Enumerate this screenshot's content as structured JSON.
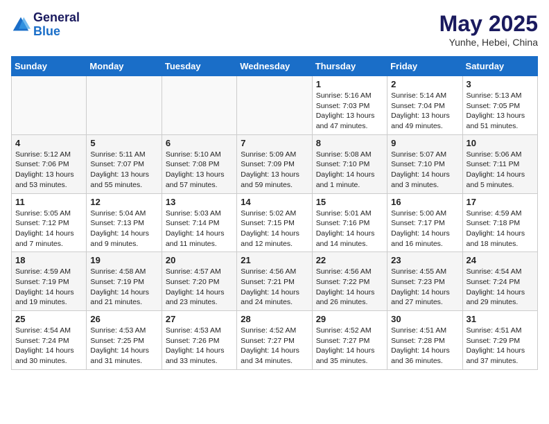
{
  "header": {
    "logo_line1": "General",
    "logo_line2": "Blue",
    "month_year": "May 2025",
    "location": "Yunhe, Hebei, China"
  },
  "weekdays": [
    "Sunday",
    "Monday",
    "Tuesday",
    "Wednesday",
    "Thursday",
    "Friday",
    "Saturday"
  ],
  "weeks": [
    [
      {
        "day": "",
        "info": ""
      },
      {
        "day": "",
        "info": ""
      },
      {
        "day": "",
        "info": ""
      },
      {
        "day": "",
        "info": ""
      },
      {
        "day": "1",
        "info": "Sunrise: 5:16 AM\nSunset: 7:03 PM\nDaylight: 13 hours\nand 47 minutes."
      },
      {
        "day": "2",
        "info": "Sunrise: 5:14 AM\nSunset: 7:04 PM\nDaylight: 13 hours\nand 49 minutes."
      },
      {
        "day": "3",
        "info": "Sunrise: 5:13 AM\nSunset: 7:05 PM\nDaylight: 13 hours\nand 51 minutes."
      }
    ],
    [
      {
        "day": "4",
        "info": "Sunrise: 5:12 AM\nSunset: 7:06 PM\nDaylight: 13 hours\nand 53 minutes."
      },
      {
        "day": "5",
        "info": "Sunrise: 5:11 AM\nSunset: 7:07 PM\nDaylight: 13 hours\nand 55 minutes."
      },
      {
        "day": "6",
        "info": "Sunrise: 5:10 AM\nSunset: 7:08 PM\nDaylight: 13 hours\nand 57 minutes."
      },
      {
        "day": "7",
        "info": "Sunrise: 5:09 AM\nSunset: 7:09 PM\nDaylight: 13 hours\nand 59 minutes."
      },
      {
        "day": "8",
        "info": "Sunrise: 5:08 AM\nSunset: 7:10 PM\nDaylight: 14 hours\nand 1 minute."
      },
      {
        "day": "9",
        "info": "Sunrise: 5:07 AM\nSunset: 7:10 PM\nDaylight: 14 hours\nand 3 minutes."
      },
      {
        "day": "10",
        "info": "Sunrise: 5:06 AM\nSunset: 7:11 PM\nDaylight: 14 hours\nand 5 minutes."
      }
    ],
    [
      {
        "day": "11",
        "info": "Sunrise: 5:05 AM\nSunset: 7:12 PM\nDaylight: 14 hours\nand 7 minutes."
      },
      {
        "day": "12",
        "info": "Sunrise: 5:04 AM\nSunset: 7:13 PM\nDaylight: 14 hours\nand 9 minutes."
      },
      {
        "day": "13",
        "info": "Sunrise: 5:03 AM\nSunset: 7:14 PM\nDaylight: 14 hours\nand 11 minutes."
      },
      {
        "day": "14",
        "info": "Sunrise: 5:02 AM\nSunset: 7:15 PM\nDaylight: 14 hours\nand 12 minutes."
      },
      {
        "day": "15",
        "info": "Sunrise: 5:01 AM\nSunset: 7:16 PM\nDaylight: 14 hours\nand 14 minutes."
      },
      {
        "day": "16",
        "info": "Sunrise: 5:00 AM\nSunset: 7:17 PM\nDaylight: 14 hours\nand 16 minutes."
      },
      {
        "day": "17",
        "info": "Sunrise: 4:59 AM\nSunset: 7:18 PM\nDaylight: 14 hours\nand 18 minutes."
      }
    ],
    [
      {
        "day": "18",
        "info": "Sunrise: 4:59 AM\nSunset: 7:19 PM\nDaylight: 14 hours\nand 19 minutes."
      },
      {
        "day": "19",
        "info": "Sunrise: 4:58 AM\nSunset: 7:19 PM\nDaylight: 14 hours\nand 21 minutes."
      },
      {
        "day": "20",
        "info": "Sunrise: 4:57 AM\nSunset: 7:20 PM\nDaylight: 14 hours\nand 23 minutes."
      },
      {
        "day": "21",
        "info": "Sunrise: 4:56 AM\nSunset: 7:21 PM\nDaylight: 14 hours\nand 24 minutes."
      },
      {
        "day": "22",
        "info": "Sunrise: 4:56 AM\nSunset: 7:22 PM\nDaylight: 14 hours\nand 26 minutes."
      },
      {
        "day": "23",
        "info": "Sunrise: 4:55 AM\nSunset: 7:23 PM\nDaylight: 14 hours\nand 27 minutes."
      },
      {
        "day": "24",
        "info": "Sunrise: 4:54 AM\nSunset: 7:24 PM\nDaylight: 14 hours\nand 29 minutes."
      }
    ],
    [
      {
        "day": "25",
        "info": "Sunrise: 4:54 AM\nSunset: 7:24 PM\nDaylight: 14 hours\nand 30 minutes."
      },
      {
        "day": "26",
        "info": "Sunrise: 4:53 AM\nSunset: 7:25 PM\nDaylight: 14 hours\nand 31 minutes."
      },
      {
        "day": "27",
        "info": "Sunrise: 4:53 AM\nSunset: 7:26 PM\nDaylight: 14 hours\nand 33 minutes."
      },
      {
        "day": "28",
        "info": "Sunrise: 4:52 AM\nSunset: 7:27 PM\nDaylight: 14 hours\nand 34 minutes."
      },
      {
        "day": "29",
        "info": "Sunrise: 4:52 AM\nSunset: 7:27 PM\nDaylight: 14 hours\nand 35 minutes."
      },
      {
        "day": "30",
        "info": "Sunrise: 4:51 AM\nSunset: 7:28 PM\nDaylight: 14 hours\nand 36 minutes."
      },
      {
        "day": "31",
        "info": "Sunrise: 4:51 AM\nSunset: 7:29 PM\nDaylight: 14 hours\nand 37 minutes."
      }
    ]
  ]
}
